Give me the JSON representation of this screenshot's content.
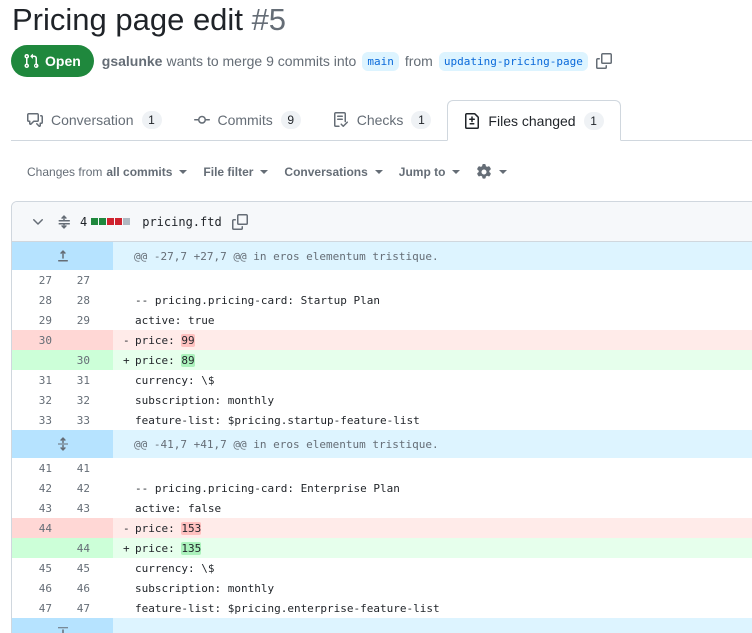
{
  "pr": {
    "title": "Pricing page edit",
    "number": "#5",
    "state": "Open",
    "author": "gsalunke",
    "merge_text": "wants to merge 9 commits into",
    "base_branch": "main",
    "from_text": "from",
    "head_branch": "updating-pricing-page"
  },
  "tabs": [
    {
      "label": "Conversation",
      "count": "1"
    },
    {
      "label": "Commits",
      "count": "9"
    },
    {
      "label": "Checks",
      "count": "1"
    },
    {
      "label": "Files changed",
      "count": "1"
    }
  ],
  "toolbar": {
    "changes_prefix": "Changes from",
    "changes_value": "all commits",
    "file_filter": "File filter",
    "conversations": "Conversations",
    "jump_to": "Jump to"
  },
  "file": {
    "change_count": "4",
    "name": "pricing.ftd",
    "stat_boxes": [
      "#1f883d",
      "#1f883d",
      "#cf222e",
      "#cf222e",
      "#afb8c1"
    ]
  },
  "colors": {
    "accent_green": "#1f883d",
    "link_blue": "#0969da",
    "deletion_red": "#cf222e"
  },
  "diff": {
    "hunk1": "@@ -27,7 +27,7 @@ in eros elementum tristique.",
    "hunk2": "@@ -41,7 +41,7 @@ in eros elementum tristique.",
    "lines": [
      {
        "old": "27",
        "new": "27",
        "sign": "",
        "text": ""
      },
      {
        "old": "28",
        "new": "28",
        "sign": "",
        "text": "-- pricing.pricing-card: Startup Plan"
      },
      {
        "old": "29",
        "new": "29",
        "sign": "",
        "text": "active: true"
      },
      {
        "old": "30",
        "new": "",
        "sign": "-",
        "text": "price: ",
        "hl": "99"
      },
      {
        "old": "",
        "new": "30",
        "sign": "+",
        "text": "price: ",
        "hl": "89"
      },
      {
        "old": "31",
        "new": "31",
        "sign": "",
        "text": "currency: \\$"
      },
      {
        "old": "32",
        "new": "32",
        "sign": "",
        "text": "subscription: monthly"
      },
      {
        "old": "33",
        "new": "33",
        "sign": "",
        "text": "feature-list: $pricing.startup-feature-list"
      },
      {
        "old": "41",
        "new": "41",
        "sign": "",
        "text": ""
      },
      {
        "old": "42",
        "new": "42",
        "sign": "",
        "text": "-- pricing.pricing-card: Enterprise Plan"
      },
      {
        "old": "43",
        "new": "43",
        "sign": "",
        "text": "active: false"
      },
      {
        "old": "44",
        "new": "",
        "sign": "-",
        "text": "price: ",
        "hl": "153"
      },
      {
        "old": "",
        "new": "44",
        "sign": "+",
        "text": "price: ",
        "hl": "135"
      },
      {
        "old": "45",
        "new": "45",
        "sign": "",
        "text": "currency: \\$"
      },
      {
        "old": "46",
        "new": "46",
        "sign": "",
        "text": "subscription: monthly"
      },
      {
        "old": "47",
        "new": "47",
        "sign": "",
        "text": "feature-list: $pricing.enterprise-feature-list"
      }
    ]
  }
}
